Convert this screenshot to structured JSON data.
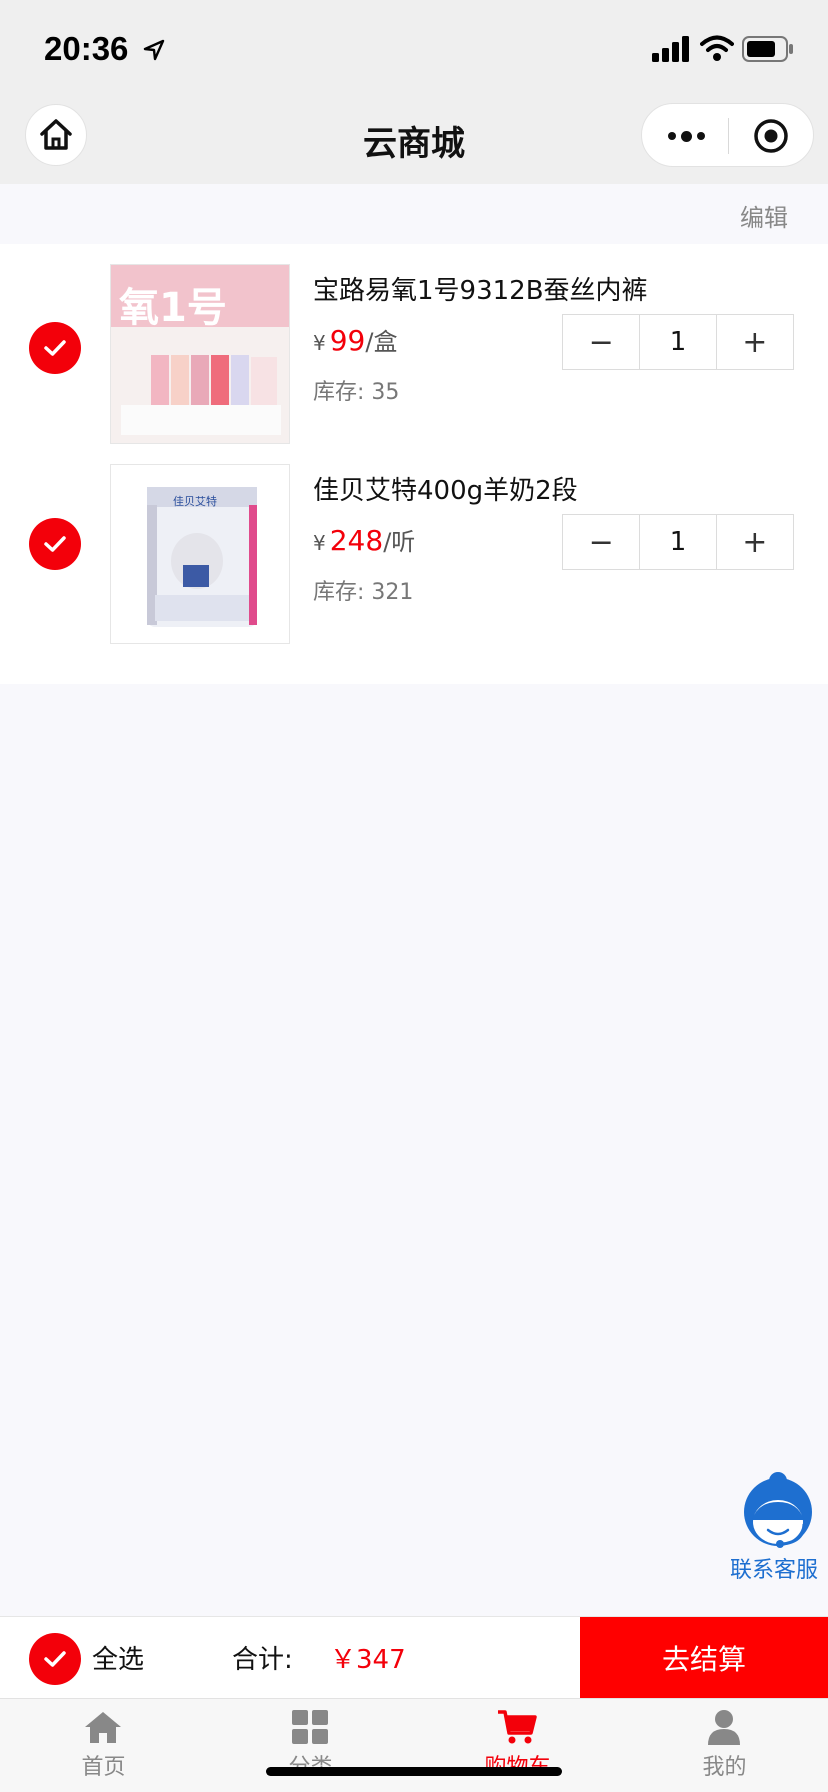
{
  "status_bar": {
    "time": "20:36"
  },
  "nav": {
    "title": "云商城"
  },
  "edit_label": "编辑",
  "items": [
    {
      "name": "宝路易氧1号9312B蚕丝内裤",
      "currency": "¥",
      "price": "99",
      "unit": "/盒",
      "stock_label": "库存:",
      "stock": "35",
      "qty": "1",
      "checked": true,
      "minus": "−",
      "plus": "+",
      "image_text": "氧1号"
    },
    {
      "name": "佳贝艾特400g羊奶2段",
      "currency": "¥",
      "price": "248",
      "unit": "/听",
      "stock_label": "库存:",
      "stock": "321",
      "qty": "1",
      "checked": true,
      "minus": "−",
      "plus": "+",
      "image_text": "佳贝艾特"
    }
  ],
  "service": {
    "label": "联系客服"
  },
  "checkout": {
    "select_all": "全选",
    "total_label": "合计:",
    "total_value": "￥347",
    "button": "去结算"
  },
  "tabs": [
    {
      "label": "首页",
      "icon": "home-icon",
      "active": false
    },
    {
      "label": "分类",
      "icon": "grid-icon",
      "active": false
    },
    {
      "label": "购物车",
      "icon": "cart-icon",
      "active": true
    },
    {
      "label": "我的",
      "icon": "user-icon",
      "active": false
    }
  ],
  "colors": {
    "accent": "#f3000a",
    "checkout_bg": "#ff0000",
    "service_blue": "#1e6fd0"
  }
}
